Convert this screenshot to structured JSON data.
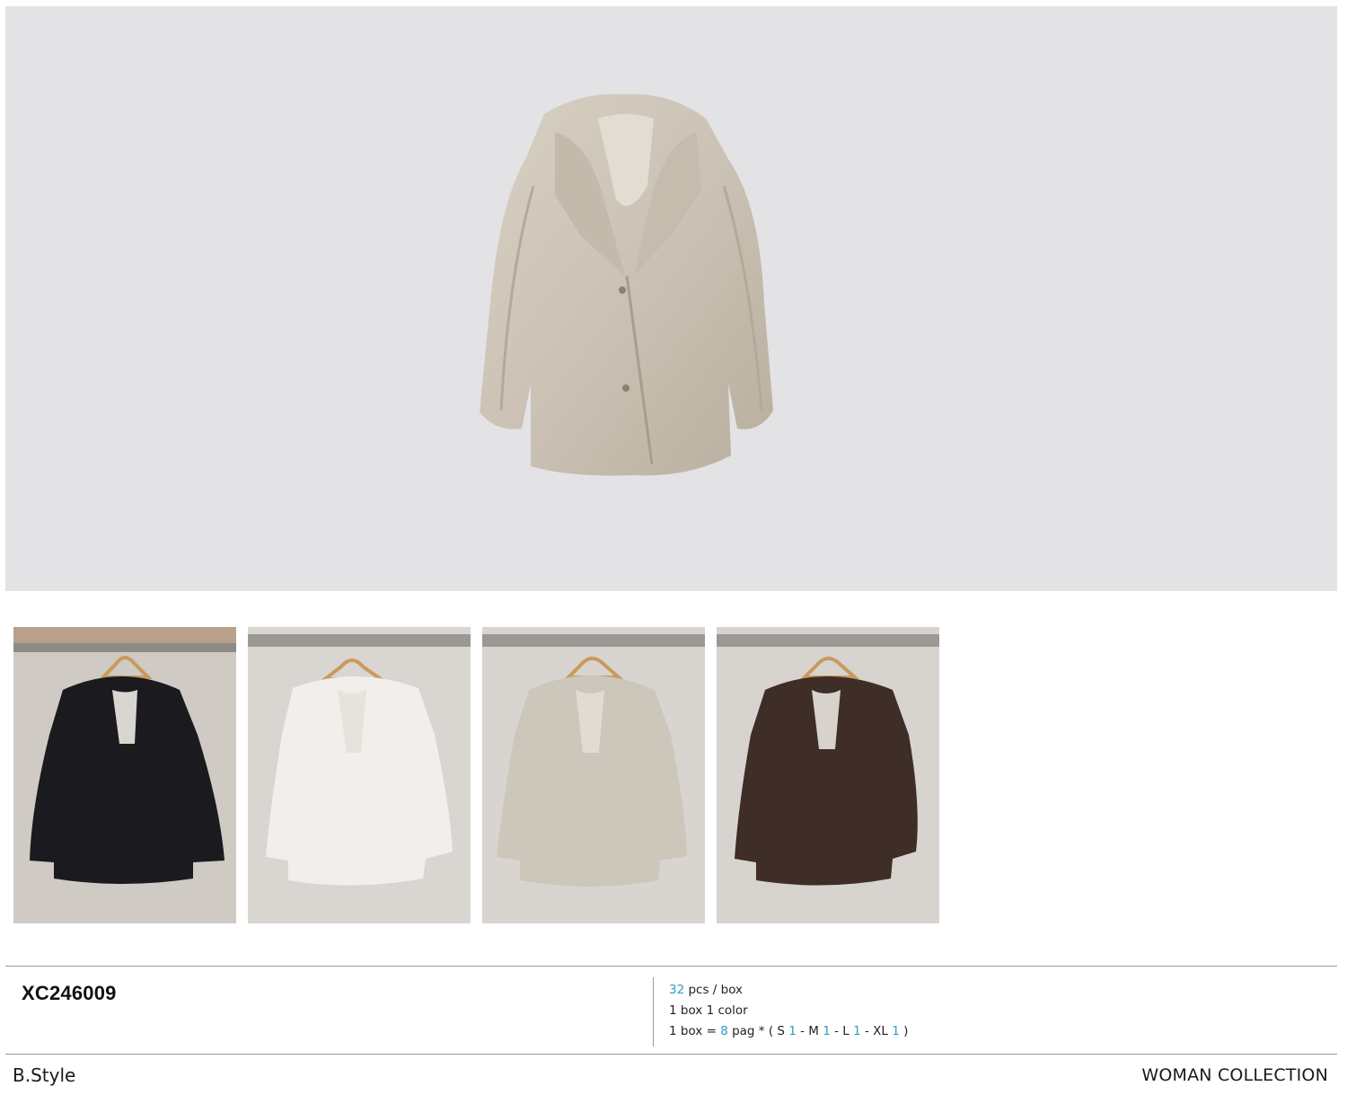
{
  "product": {
    "sku": "XC246009"
  },
  "specs": {
    "line1": {
      "qty": "32",
      "text": " pcs / box"
    },
    "line2": {
      "text": "1 box 1 color"
    },
    "line3": {
      "prefix": "1 box = ",
      "packs": "8",
      "mid": " pag * ( S ",
      "s": "1",
      "m_label": " - M ",
      "m": "1",
      "l_label": " - L ",
      "l": "1",
      "xl_label": " - XL ",
      "xl": "1",
      "suffix": " )"
    }
  },
  "footer": {
    "brand": "B.Style",
    "collection": "WOMAN COLLECTION"
  },
  "colors": {
    "hero_bg": "#e3e2e5",
    "accent_number": "#2a9fc4",
    "variants": [
      "#1b1b1f",
      "#f1efeb",
      "#cdc6bb",
      "#3f2d27"
    ]
  },
  "images": {
    "hero": "beige-faux-fur-coat-photo",
    "variants": [
      "black-coat-on-hanger-photo",
      "white-coat-on-hanger-photo",
      "beige-coat-on-hanger-photo",
      "brown-coat-on-hanger-photo"
    ]
  }
}
